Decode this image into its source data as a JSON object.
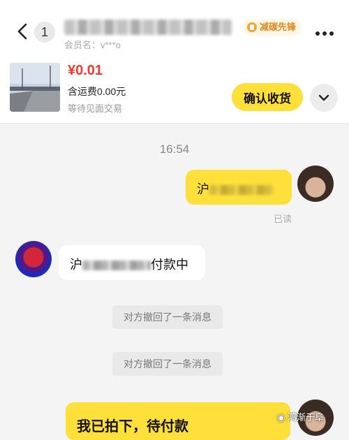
{
  "header": {
    "unread_count": "1",
    "member_label": "会员名：v***o",
    "carbon_badge": "减碳先锋"
  },
  "order": {
    "price": "¥0.01",
    "shipping": "含运费0.00元",
    "status": "等待见面交易",
    "confirm_label": "确认收货"
  },
  "chat": {
    "time": "16:54",
    "my_message_prefix": "沪",
    "read_receipt": "已读",
    "other_message_prefix": "沪",
    "other_message_suffix": "付款中",
    "system_notice_1": "对方撤回了一条消息",
    "system_notice_2": "对方撤回了一条消息",
    "last_message": "我已拍下，待付款"
  },
  "watermark": "鸿渐于阜",
  "colors": {
    "accent_yellow": "#ffe03a",
    "price_red": "#f23a2e"
  }
}
